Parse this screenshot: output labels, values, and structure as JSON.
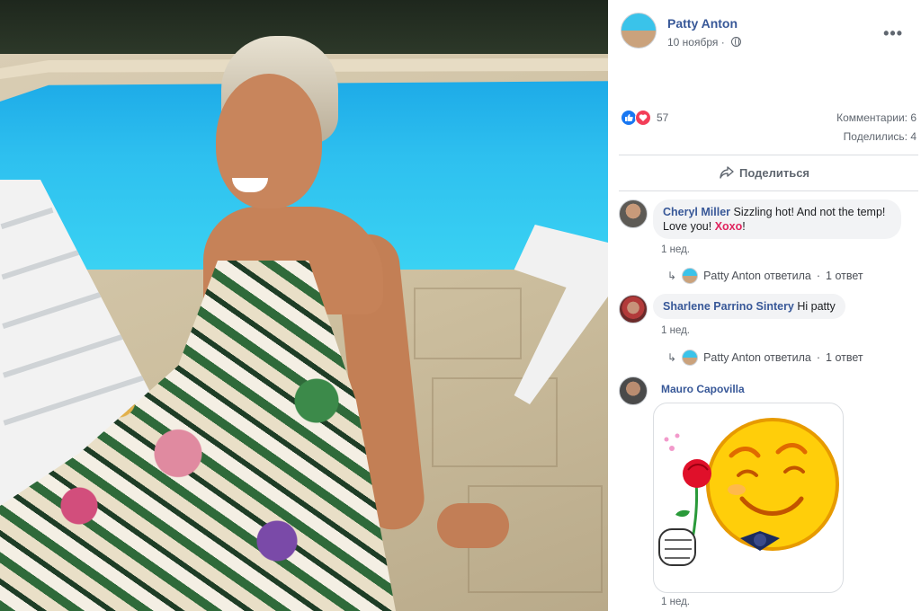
{
  "post": {
    "author": "Patty Anton",
    "date": "10 ноября",
    "privacy_icon": "globe-icon",
    "more_label": "•••"
  },
  "reactions": {
    "count": "57",
    "icons": [
      "like-icon",
      "love-icon"
    ]
  },
  "stats": {
    "comments": "Комментарии: 6",
    "shares": "Поделились: 4"
  },
  "actions": {
    "share_label": "Поделиться"
  },
  "comments": [
    {
      "name": "Cheryl Miller",
      "text": "Sizzling hot! And not the temp! Love you!",
      "highlight": "Xoxo",
      "trail": "!",
      "time": "1 нед.",
      "reply_author": "Patty Anton ответила",
      "reply_count": "1 ответ"
    },
    {
      "name": "Sharlene Parrino Sintery",
      "text": "Hi patty",
      "time": "1 нед.",
      "reply_author": "Patty Anton ответила",
      "reply_count": "1 ответ"
    },
    {
      "name": "Mauro Capovilla",
      "time": "1 нед.",
      "sticker": "smiley-with-rose-sticker"
    }
  ],
  "colors": {
    "link": "#385898",
    "like": "#1877f2",
    "love": "#f33e58",
    "bubble": "#f2f3f5",
    "pool": "#2ec0ef"
  }
}
